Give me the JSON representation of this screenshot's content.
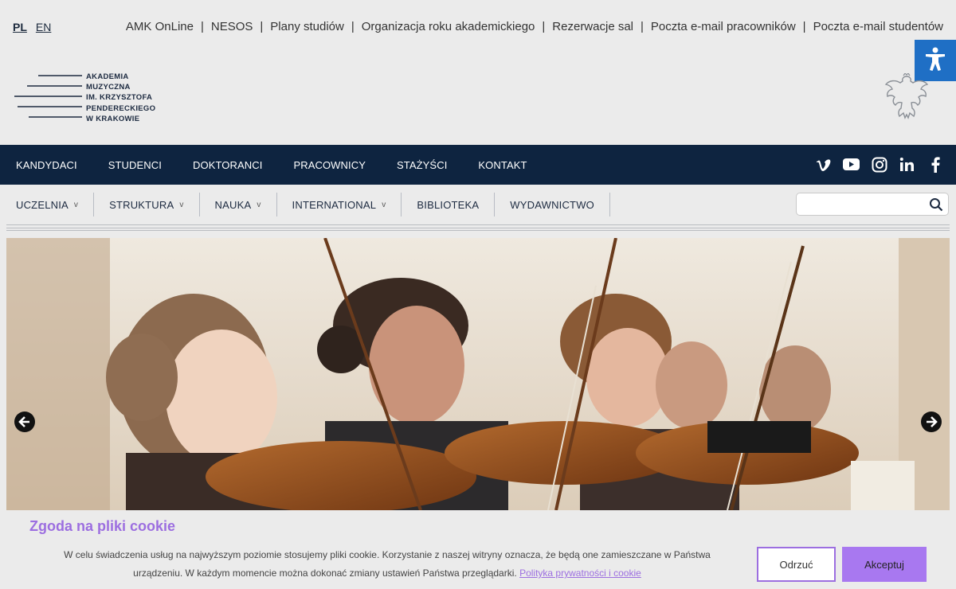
{
  "lang": {
    "pl": "PL",
    "en": "EN"
  },
  "toplinks": [
    "AMK OnLine",
    "NESOS",
    "Plany studiów",
    "Organizacja roku akademickiego",
    "Rezerwacje sal",
    "Poczta e-mail pracowników",
    "Poczta e-mail studentów"
  ],
  "toplinks_separator": "|",
  "logo": {
    "lines": [
      "AKADEMIA",
      "MUZYCZNA",
      "IM. KRZYSZTOFA",
      "PENDERECKIEGO",
      "W KRAKOWIE"
    ]
  },
  "mainnav": [
    "KANDYDACI",
    "STUDENCI",
    "DOKTORANCI",
    "PRACOWNICY",
    "STAŻYŚCI",
    "KONTAKT"
  ],
  "social": [
    "vimeo-icon",
    "youtube-icon",
    "instagram-icon",
    "linkedin-icon",
    "facebook-icon"
  ],
  "subnav": [
    {
      "label": "UCZELNIA",
      "dropdown": true
    },
    {
      "label": "STRUKTURA",
      "dropdown": true
    },
    {
      "label": "NAUKA",
      "dropdown": true
    },
    {
      "label": "INTERNATIONAL",
      "dropdown": true
    },
    {
      "label": "BIBLIOTEKA",
      "dropdown": false
    },
    {
      "label": "WYDAWNICTWO",
      "dropdown": false
    }
  ],
  "chevron": "v",
  "search": {
    "placeholder": ""
  },
  "cookie": {
    "title": "Zgoda na pliki cookie",
    "text": "W celu świadczenia usług na najwyższym poziomie stosujemy pliki cookie. Korzystanie z naszej witryny oznacza, że będą one zamieszczane w Państwa urządzeniu. W każdym momencie można dokonać zmiany ustawień Państwa przeglądarki.",
    "link": "Polityka prywatności i cookie",
    "reject": "Odrzuć",
    "accept": "Akceptuj"
  },
  "colors": {
    "navy": "#0e2440",
    "accent": "#9c6ee0",
    "accessibility": "#1f6fc5"
  }
}
